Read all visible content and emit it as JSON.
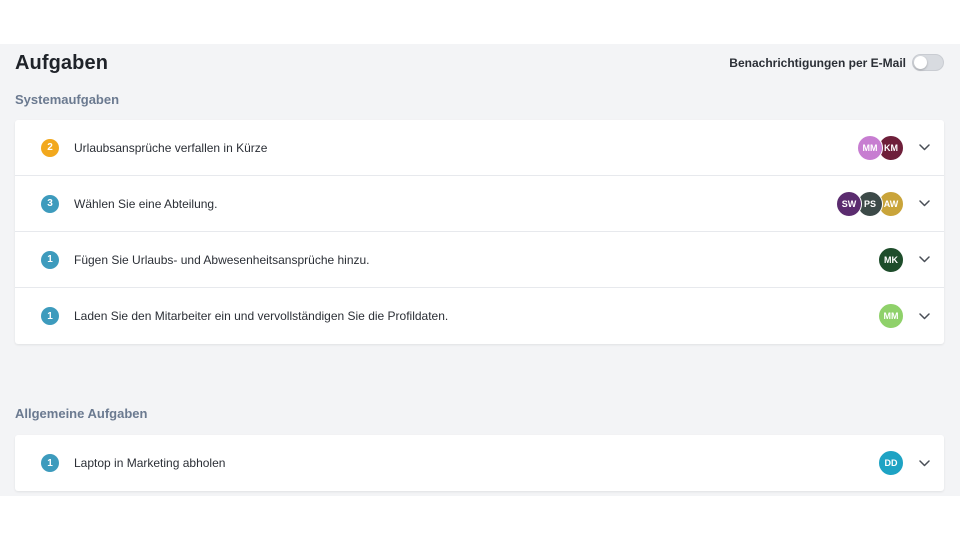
{
  "header": {
    "title": "Aufgaben",
    "notification_label": "Benachrichtigungen per E-Mail",
    "notification_enabled": false
  },
  "colors": {
    "orange": "#f2a81d",
    "blue": "#3d9bbd",
    "toggle_off": "#d8dbe0"
  },
  "system": {
    "title": "Systemaufgaben",
    "tasks": [
      {
        "count": "2",
        "label": "Urlaubsansprüche verfallen in Kürze",
        "badge_color": "#f2a81d",
        "avatars": [
          {
            "initials": "MM",
            "color": "#c77dd1"
          },
          {
            "initials": "KM",
            "color": "#6e1f3a"
          }
        ]
      },
      {
        "count": "3",
        "label": "Wählen Sie eine Abteilung.",
        "badge_color": "#3d9bbd",
        "avatars": [
          {
            "initials": "SW",
            "color": "#5b2c6f"
          },
          {
            "initials": "PS",
            "color": "#3c4a48"
          },
          {
            "initials": "AW",
            "color": "#c9a43a"
          }
        ]
      },
      {
        "count": "1",
        "label": "Fügen Sie Urlaubs- und Abwesenheitsansprüche hinzu.",
        "badge_color": "#3d9bbd",
        "avatars": [
          {
            "initials": "MK",
            "color": "#1e4d2b"
          }
        ]
      },
      {
        "count": "1",
        "label": "Laden Sie den Mitarbeiter ein und vervollständigen Sie die Profildaten.",
        "badge_color": "#3d9bbd",
        "avatars": [
          {
            "initials": "MM",
            "color": "#8fd16a"
          }
        ]
      }
    ]
  },
  "general": {
    "title": "Allgemeine Aufgaben",
    "tasks": [
      {
        "count": "1",
        "label": "Laptop in Marketing abholen",
        "badge_color": "#3d9bbd",
        "avatars": [
          {
            "initials": "DD",
            "color": "#1ea3c4"
          }
        ]
      }
    ]
  }
}
